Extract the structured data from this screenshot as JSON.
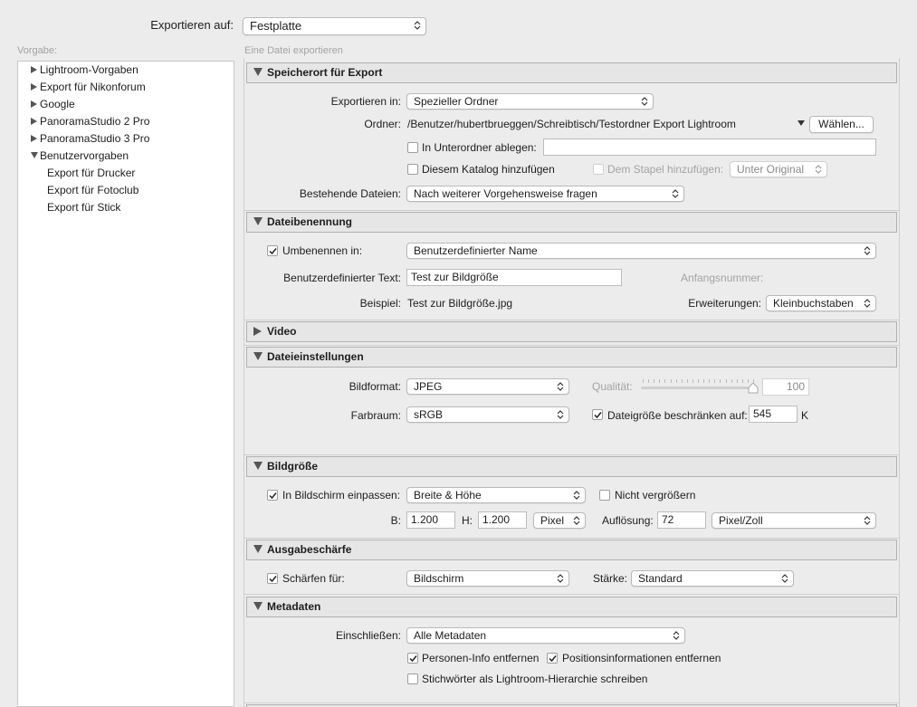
{
  "header": {
    "export_to_label": "Exportieren auf:",
    "export_to_value": "Festplatte"
  },
  "presets": {
    "label": "Vorgabe:",
    "items": [
      {
        "label": "Lightroom-Vorgaben"
      },
      {
        "label": "Export für Nikonforum"
      },
      {
        "label": "Google"
      },
      {
        "label": "PanoramaStudio 2 Pro"
      },
      {
        "label": "PanoramaStudio 3 Pro"
      },
      {
        "label": "Benutzervorgaben"
      }
    ],
    "user_items": [
      {
        "label": "Export für Drucker"
      },
      {
        "label": "Export für Fotoclub"
      },
      {
        "label": "Export für Stick"
      }
    ]
  },
  "main": {
    "subtitle": "Eine Datei exportieren"
  },
  "location": {
    "title": "Speicherort für Export",
    "export_in_label": "Exportieren in:",
    "export_in_value": "Spezieller Ordner",
    "folder_label": "Ordner:",
    "folder_path": "/Benutzer/hubertbrueggen/Schreibtisch/Testordner Export Lightroom",
    "choose_button": "Wählen...",
    "subfolder_label": "In Unterordner ablegen:",
    "subfolder_value": "",
    "catalog_label": "Diesem Katalog hinzufügen",
    "stack_label": "Dem Stapel hinzufügen:",
    "stack_value": "Unter Original",
    "existing_label": "Bestehende Dateien:",
    "existing_value": "Nach weiterer Vorgehensweise fragen"
  },
  "naming": {
    "title": "Dateibenennung",
    "rename_label": "Umbenennen in:",
    "rename_value": "Benutzerdefinierter Name",
    "custom_text_label": "Benutzerdefinierter Text:",
    "custom_text_value": "Test zur Bildgröße",
    "start_number_label": "Anfangsnummer:",
    "example_label": "Beispiel:",
    "example_value": "Test zur Bildgröße.jpg",
    "extensions_label": "Erweiterungen:",
    "extensions_value": "Kleinbuchstaben"
  },
  "video": {
    "title": "Video"
  },
  "file_settings": {
    "title": "Dateieinstellungen",
    "format_label": "Bildformat:",
    "format_value": "JPEG",
    "quality_label": "Qualität:",
    "quality_value": "100",
    "quality_fraction": 1.0,
    "colorspace_label": "Farbraum:",
    "colorspace_value": "sRGB",
    "limit_label": "Dateigröße beschränken auf:",
    "limit_value": "545",
    "limit_unit": "K"
  },
  "image_size": {
    "title": "Bildgröße",
    "fit_label": "In Bildschirm einpassen:",
    "fit_value": "Breite & Höhe",
    "no_enlarge_label": "Nicht vergrößern",
    "w_label": "B:",
    "w_value": "1.200",
    "h_label": "H:",
    "h_value": "1.200",
    "unit_value": "Pixel",
    "resolution_label": "Auflösung:",
    "resolution_value": "72",
    "resolution_unit": "Pixel/Zoll"
  },
  "sharpening": {
    "title": "Ausgabeschärfe",
    "sharpen_label": "Schärfen für:",
    "sharpen_value": "Bildschirm",
    "strength_label": "Stärke:",
    "strength_value": "Standard"
  },
  "metadata": {
    "title": "Metadaten",
    "include_label": "Einschließen:",
    "include_value": "Alle Metadaten",
    "remove_person_label": "Personen-Info entfernen",
    "remove_location_label": "Positionsinformationen entfernen",
    "keywords_label": "Stichwörter als Lightroom-Hierarchie schreiben"
  },
  "colors": {
    "background": "#ececec",
    "panel_header": "#e6e6e6",
    "border": "#b1b1b1"
  }
}
